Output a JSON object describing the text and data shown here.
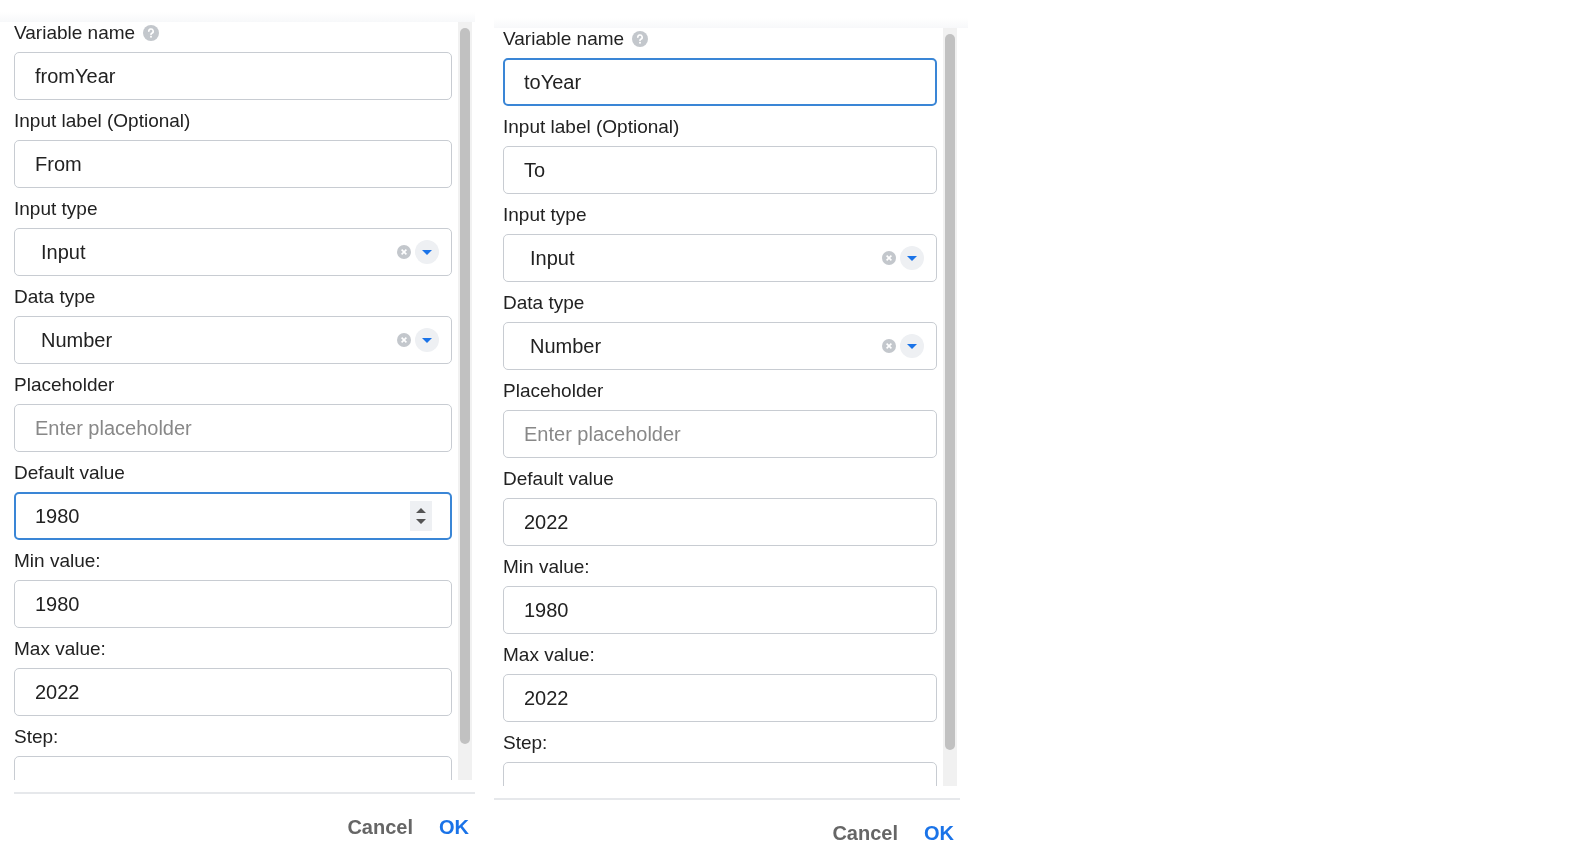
{
  "dialogs": [
    {
      "fields": [
        {
          "label": "Variable name",
          "help": true,
          "kind": "text",
          "value": "fromYear",
          "focused": false
        },
        {
          "label": "Input label (Optional)",
          "help": false,
          "kind": "text",
          "value": "From",
          "focused": false
        },
        {
          "label": "Input type",
          "help": false,
          "kind": "select",
          "value": "Input",
          "focused": false
        },
        {
          "label": "Data type",
          "help": false,
          "kind": "select",
          "value": "Number",
          "focused": false
        },
        {
          "label": "Placeholder",
          "help": false,
          "kind": "text",
          "placeholder": "Enter placeholder",
          "focused": false
        },
        {
          "label": "Default value",
          "help": false,
          "kind": "number",
          "value": "1980",
          "focused": true
        },
        {
          "label": "Min value:",
          "help": false,
          "kind": "text",
          "value": "1980",
          "focused": false
        },
        {
          "label": "Max value:",
          "help": false,
          "kind": "text",
          "value": "2022",
          "focused": false
        },
        {
          "label": "Step:",
          "help": false,
          "kind": "text",
          "focused": false
        }
      ],
      "buttons": [
        "Cancel",
        "OK"
      ]
    },
    {
      "fields": [
        {
          "label": "Variable name",
          "help": true,
          "kind": "text",
          "value": "toYear",
          "focused": true
        },
        {
          "label": "Input label (Optional)",
          "help": false,
          "kind": "text",
          "value": "To",
          "focused": false
        },
        {
          "label": "Input type",
          "help": false,
          "kind": "select",
          "value": "Input",
          "focused": false
        },
        {
          "label": "Data type",
          "help": false,
          "kind": "select",
          "value": "Number",
          "focused": false
        },
        {
          "label": "Placeholder",
          "help": false,
          "kind": "text",
          "placeholder": "Enter placeholder",
          "focused": false
        },
        {
          "label": "Default value",
          "help": false,
          "kind": "number",
          "value": "2022",
          "focused": false
        },
        {
          "label": "Min value:",
          "help": false,
          "kind": "text",
          "value": "1980",
          "focused": false
        },
        {
          "label": "Max value:",
          "help": false,
          "kind": "text",
          "value": "2022",
          "focused": false
        },
        {
          "label": "Step:",
          "help": false,
          "kind": "text",
          "focused": false
        }
      ],
      "buttons": [
        "Cancel",
        "OK"
      ]
    }
  ]
}
